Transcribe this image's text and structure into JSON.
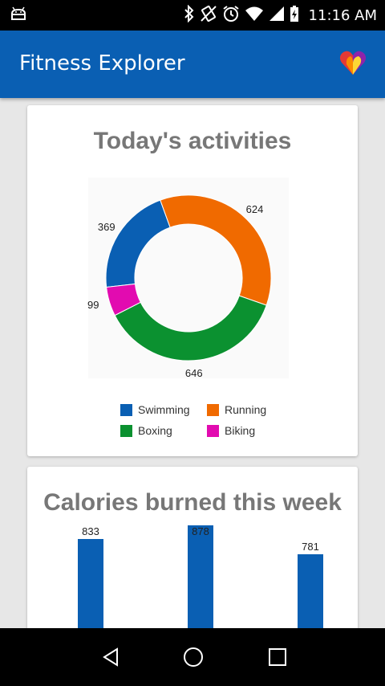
{
  "status_bar": {
    "time": "11:16 AM",
    "icons": [
      "android-debug-icon",
      "bluetooth-icon",
      "vibrate-icon",
      "alarm-icon",
      "wifi-icon",
      "signal-icon",
      "battery-charging-icon"
    ]
  },
  "app_bar": {
    "title": "Fitness Explorer",
    "logo_icon": "google-fit-heart-icon"
  },
  "activities_card": {
    "title": "Today's activities",
    "chart_data": {
      "type": "pie",
      "donut": true,
      "categories": [
        "Swimming",
        "Running",
        "Boxing",
        "Biking"
      ],
      "values": [
        369,
        624,
        646,
        99
      ],
      "colors": [
        "#0a5fb3",
        "#f06a00",
        "#0b9130",
        "#e20bb0"
      ],
      "legend_position": "bottom"
    }
  },
  "calories_card": {
    "title": "Calories burned this week",
    "chart_data": {
      "type": "bar",
      "values": [
        833,
        878,
        781
      ],
      "color": "#0a5fb3"
    }
  },
  "nav_bar": {
    "icons": [
      "back-icon",
      "home-icon",
      "recents-icon"
    ]
  }
}
